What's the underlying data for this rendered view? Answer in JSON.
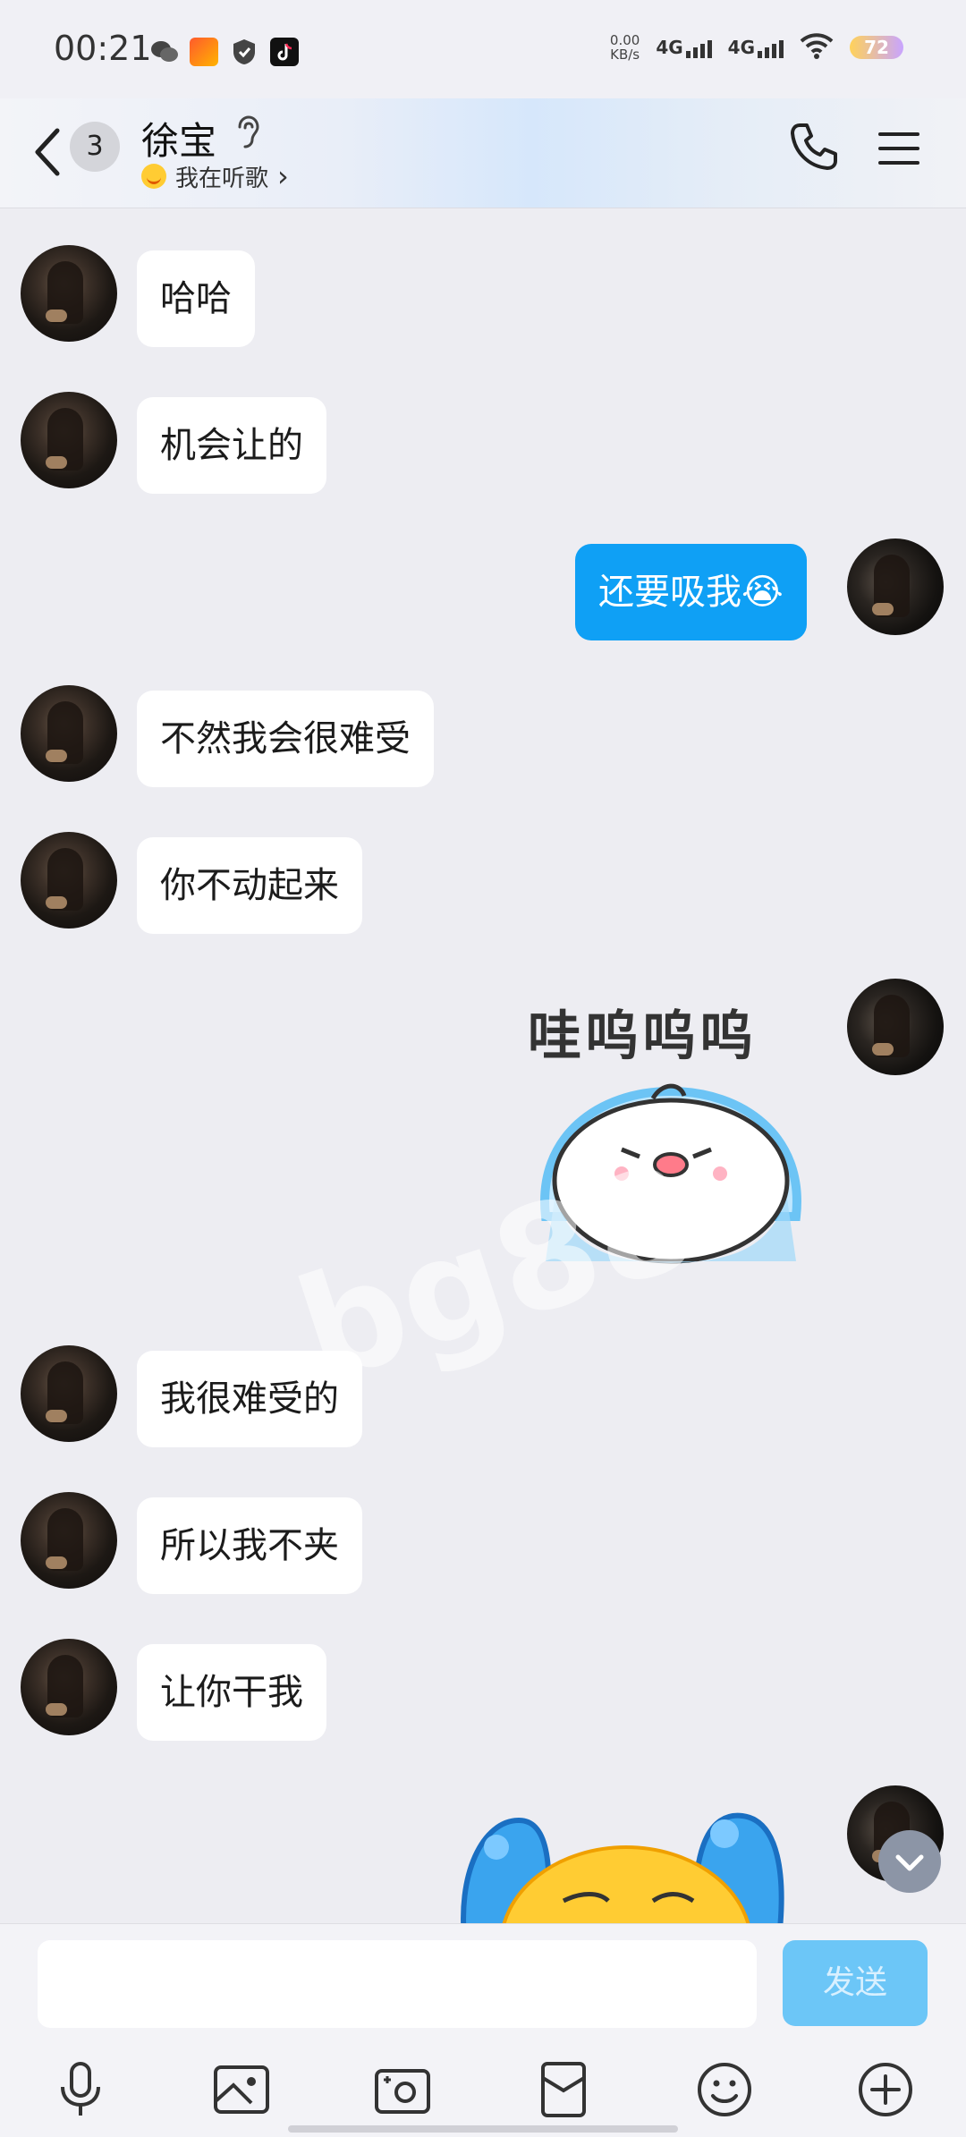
{
  "status_bar": {
    "time": "00:21",
    "net_speed_value": "0.00",
    "net_speed_unit": "KB/s",
    "sim1": "4G",
    "sim2": "4G",
    "battery": "72"
  },
  "header": {
    "unread_count": "3",
    "contact_name": "徐宝",
    "status_text": "我在听歌",
    "status_arrow": "›"
  },
  "messages": [
    {
      "side": "left",
      "text": "哈哈"
    },
    {
      "side": "left",
      "text": "机会让的"
    },
    {
      "side": "right",
      "text": "还要吸我😭"
    },
    {
      "side": "left",
      "text": "不然我会很难受"
    },
    {
      "side": "left",
      "text": "你不动起来"
    },
    {
      "side": "right",
      "sticker_text": "哇呜呜呜"
    },
    {
      "side": "left",
      "text": "我很难受的"
    },
    {
      "side": "left",
      "text": "所以我不夹"
    },
    {
      "side": "left",
      "text": "让你干我"
    }
  ],
  "watermark": "bg88",
  "input": {
    "value": "",
    "send_label": "发送"
  },
  "toolbar": {
    "icons": [
      "microphone-icon",
      "image-icon",
      "camera-icon",
      "red-packet-icon",
      "emoji-icon",
      "plus-icon"
    ]
  },
  "colors": {
    "my_bubble": "#0fa0f5",
    "send_button": "#6cc6f7",
    "background": "#ededf2"
  }
}
